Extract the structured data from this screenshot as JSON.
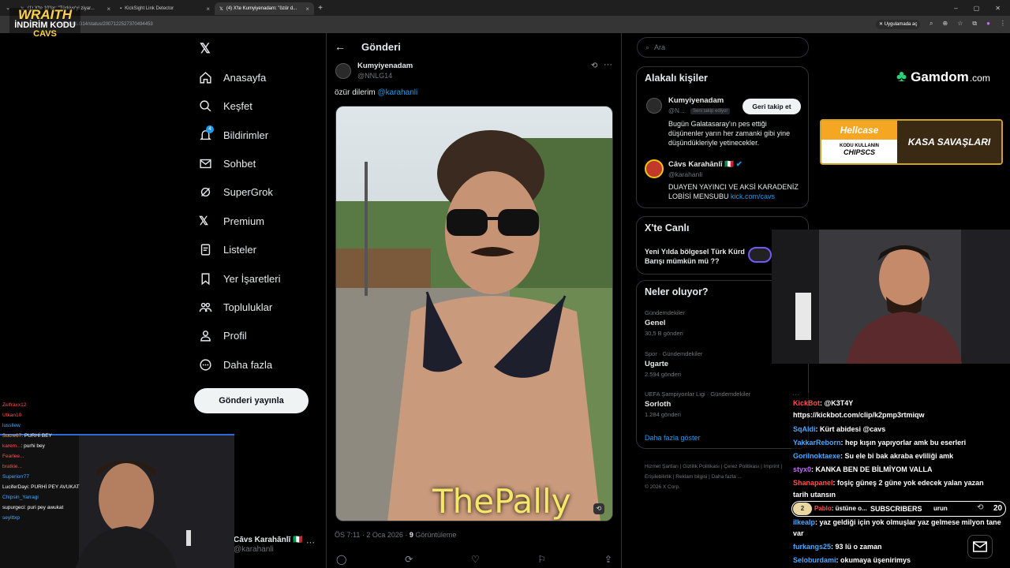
{
  "browser": {
    "tabs": [
      {
        "label": "(1) X'te 10'lar: \"Türkiye'yi ziyar..."
      },
      {
        "label": "KickSight Link Detector"
      },
      {
        "label": "(4) X'te Kumyiyenadam: \"özür d..."
      }
    ],
    "url": "x.com/NNLG14/status/2007122527370494453",
    "open_in_app": "Uygulamada aç"
  },
  "overlay": {
    "brand_top": "WRAITH",
    "brand_mid": "İNDİRİM KODU",
    "brand_bot": "CAVS"
  },
  "nav": {
    "items": [
      "Anasayfa",
      "Keşfet",
      "Bildirimler",
      "Sohbet",
      "SuperGrok",
      "Premium",
      "Listeler",
      "Yer İşaretleri",
      "Topluluklar",
      "Profil",
      "Daha fazla"
    ],
    "notif_count": "4",
    "post_button": "Gönderi yayınla",
    "account_name": "Cāvs Karahānlī 🇮🇹",
    "account_handle": "@karahanli"
  },
  "post": {
    "header_title": "Gönderi",
    "author_name": "Kumyiyenadam",
    "author_handle": "@NNLG14",
    "text_prefix": "özür dilerim ",
    "mention": "@karahanli",
    "watermark": "ThePally",
    "meta_time": "ÖS 7:11 · 2 Oca 2026 · ",
    "meta_views_count": "9",
    "meta_views_label": " Görüntüleme"
  },
  "right": {
    "search_placeholder": "Ara",
    "related_title": "Alakalı kişiler",
    "person1": {
      "name": "Kumyiyenadam",
      "handle": "@N...",
      "follows_you": "Seni takip ediyor",
      "button": "Geri takip et",
      "bio": "Bugün Galatasaray'ın pes ettiği düşünenler yarın her zamanki gibi yine düşündükleriyle yetinecekler."
    },
    "person2": {
      "name": "Cāvs Karahānlī 🇮🇹",
      "handle": "@karahanli",
      "bio": "DUAYEN YAYINCI VE AKSİ KARADENİZ LOBİSİ MENSUBU ",
      "link": "kick.com/cavs"
    },
    "live_title": "X'te Canlı",
    "live_text": "Yeni Yılda bölgesel Türk Kürd Barışı mümkün mü ??",
    "trends_title": "Neler oluyor?",
    "trends": [
      {
        "context": "Gündemdekiler",
        "name": "Genel",
        "count": "30,5 B gönderi"
      },
      {
        "context": "Spor · Gündemdekiler",
        "name": "Ugarte",
        "count": "2.594 gönderi"
      },
      {
        "context": "UEFA Şampiyonlar Ligi · Gündemdekiler",
        "name": "Sorloth",
        "count": "1.284 gönderi"
      }
    ],
    "show_more": "Daha fazla göster",
    "footer": [
      "Hizmet Şartları",
      "Gizlilik Politikası",
      "Çerez Politikası",
      "Erişilebilirlik",
      "Reklam bilgisi",
      "Daha fazla ...",
      "Imprint",
      "© 2026 X Corp."
    ]
  },
  "ads": {
    "gamdom": "Gamdom",
    "gamdom_suffix": ".com",
    "hellcase": "Hellcase",
    "hellcase_sub": "KODU KULLANIN",
    "hellcase_code": "CHIPSCS",
    "hellcase_cta": "KASA SAVAŞLARI"
  },
  "chat": [
    {
      "user": "KickBot",
      "color": "#ff4d4d",
      "msg": ": @K3T4Y"
    },
    {
      "user": "",
      "color": "#ffffff",
      "msg": "https://kickbot.com/clip/k2pmp3rtmiqw"
    },
    {
      "user": "SqAldi",
      "color": "#4aa8ff",
      "msg": ": Kürt abidesi @cavs"
    },
    {
      "user": "YakkarReborn",
      "color": "#4aa8ff",
      "msg": ": hep kışın yapıyorlar amk bu eserleri"
    },
    {
      "user": "Gorilnoktaexe",
      "color": "#4aa8ff",
      "msg": ": Su ele bi bak akraba evliliği amk"
    },
    {
      "user": "styx0",
      "color": "#c86bff",
      "msg": ": KANKA BEN DE BİLMİYOM VALLA"
    },
    {
      "user": "Shanapanel",
      "color": "#ff4d4d",
      "msg": ": foşiç güneş 2 güne yok edecek yalan yazan"
    },
    {
      "user": "",
      "color": "#ffffff",
      "msg": "tarih utansın"
    },
    {
      "user": "Pablo",
      "color": "#ff4d4d",
      "msg": ": üstüne o..."
    },
    {
      "user": "ilkealp",
      "color": "#4aa8ff",
      "msg": ": yaz geldiği için yok olmuşlar yaz gelmese milyon tane"
    },
    {
      "user": "",
      "color": "#ffffff",
      "msg": "var"
    },
    {
      "user": "furkangs25",
      "color": "#4aa8ff",
      "msg": ": 93 lü o zaman"
    },
    {
      "user": "Seloburdami",
      "color": "#4aa8ff",
      "msg": ": okumaya üşenirimys"
    }
  ],
  "subscribers": {
    "label": "SUBSCRIBERS",
    "left_num": "2",
    "count": "20",
    "trail": "urun"
  },
  "left_chat": [
    {
      "user": "Zelfraxx12",
      "color": "#ff4d4d",
      "msg": ""
    },
    {
      "user": "Utkan10",
      "color": "#ff4d4d",
      "msg": ""
    },
    {
      "user": "lussllew",
      "color": "#4aa8ff",
      "msg": ""
    },
    {
      "user": "Sucre67",
      "color": "#ffae42",
      "msg": ": PURHİ BEY"
    },
    {
      "user": "karem...",
      "color": "#ff4d4d",
      "msg": ": purhi bey"
    },
    {
      "user": "Fearlee...",
      "color": "#ff4d4d",
      "msg": ""
    },
    {
      "user": "bratkie...",
      "color": "#ff4d4d",
      "msg": ""
    },
    {
      "user": "Superiorr77",
      "color": "#4aa8ff",
      "msg": ""
    },
    {
      "user": "LuciferDayi",
      "color": "#ffffff",
      "msg": ": PURHİ PEY AVUKAT"
    },
    {
      "user": "Chipsin_Yarragi",
      "color": "#4aa8ff",
      "msg": ""
    },
    {
      "user": "supurgeci",
      "color": "#ffffff",
      "msg": ": puri pey awukat"
    },
    {
      "user": "seyittxp",
      "color": "#4aa8ff",
      "msg": ""
    }
  ]
}
